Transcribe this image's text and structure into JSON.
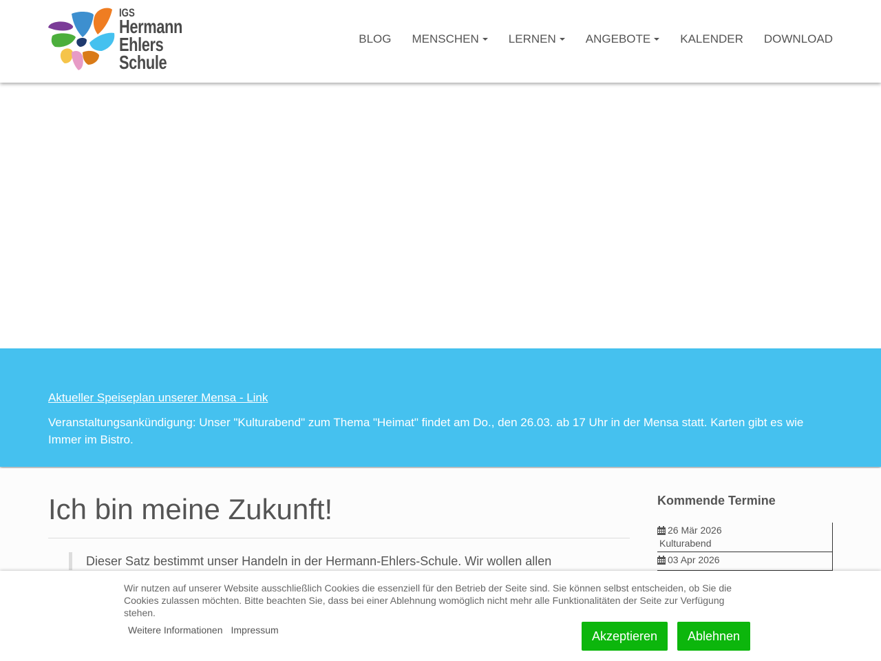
{
  "logo": {
    "igs": "IGS",
    "line1": "Hermann",
    "line2": "Ehlers",
    "line3": "Schule"
  },
  "nav": [
    {
      "label": "BLOG",
      "dropdown": false
    },
    {
      "label": "MENSCHEN",
      "dropdown": true
    },
    {
      "label": "LERNEN",
      "dropdown": true
    },
    {
      "label": "ANGEBOTE",
      "dropdown": true
    },
    {
      "label": "KALENDER",
      "dropdown": false
    },
    {
      "label": "DOWNLOAD",
      "dropdown": false
    }
  ],
  "banner": {
    "link": "Aktueller Speiseplan unserer Mensa - Link",
    "text": "Veranstaltungsankündigung: Unser \"Kulturabend\" zum Thema \"Heimat\" findet am Do., den 26.03. ab 17 Uhr in der Mensa statt. Karten gibt es wie Immer im Bistro."
  },
  "main": {
    "title": "Ich bin meine Zukunft!",
    "quote": "Dieser Satz bestimmt unser Handeln in der Hermann-Ehlers-Schule. Wir wollen allen"
  },
  "sidebar": {
    "title": "Kommende Termine",
    "events": [
      {
        "date": "26 Mär 2026",
        "name": "Kulturabend"
      },
      {
        "date": "03 Apr 2026",
        "name": ""
      }
    ]
  },
  "cookie": {
    "text": "Wir nutzen auf unserer Website ausschließlich Cookies die essenziell für den Betrieb der Seite sind. Sie können selbst entscheiden, ob Sie die Cookies zulassen möchten. Bitte beachten Sie, dass bei einer Ablehnung womöglich nicht mehr alle Funktionalitäten der Seite zur Verfügung stehen.",
    "more_info": "Weitere Informationen",
    "imprint": "Impressum",
    "accept": "Akzeptieren",
    "decline": "Ablehnen"
  },
  "colors": {
    "banner": "#45c1ef",
    "button": "#0cb60c"
  }
}
